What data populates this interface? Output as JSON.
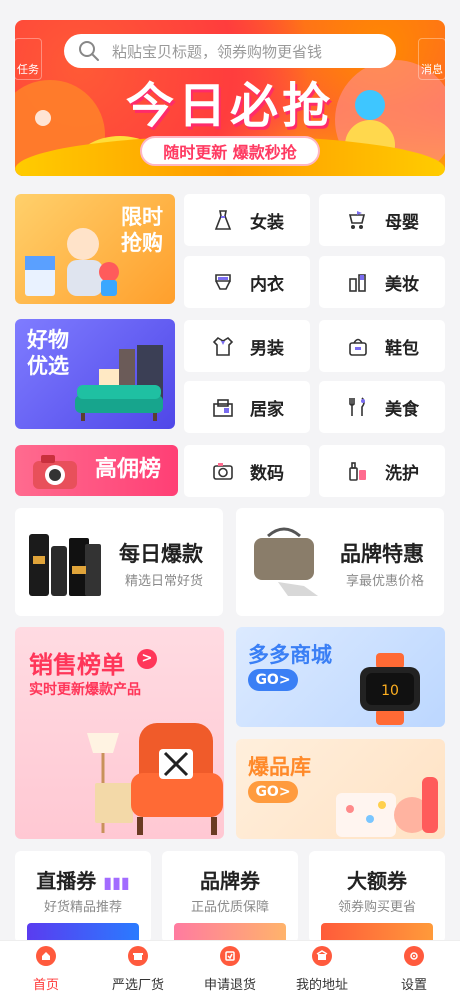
{
  "header": {
    "left_tag": "任务",
    "right_tag": "消息",
    "search_placeholder": "粘贴宝贝标题，领券购物更省钱",
    "banner_title": "今日必抢",
    "banner_pill": "随时更新 爆款秒抢"
  },
  "promos": {
    "limited": "限时\n抢购",
    "good": "好物\n优选",
    "high": "高佣榜"
  },
  "categories": [
    {
      "label": "女装",
      "icon": "dress-icon"
    },
    {
      "label": "母婴",
      "icon": "stroller-icon"
    },
    {
      "label": "内衣",
      "icon": "underwear-icon"
    },
    {
      "label": "美妆",
      "icon": "cosmetics-icon"
    },
    {
      "label": "男装",
      "icon": "shirt-icon"
    },
    {
      "label": "鞋包",
      "icon": "bag-icon"
    },
    {
      "label": "居家",
      "icon": "home-icon"
    },
    {
      "label": "美食",
      "icon": "utensils-icon"
    },
    {
      "label": "数码",
      "icon": "camera-icon"
    },
    {
      "label": "洗护",
      "icon": "bottles-icon"
    }
  ],
  "wide_cards": [
    {
      "title": "每日爆款",
      "subtitle": "精选日常好货"
    },
    {
      "title": "品牌特惠",
      "subtitle": "享最优惠价格"
    }
  ],
  "sales": {
    "title": "销售榜单",
    "arrow": ">",
    "subtitle": "实时更新爆款产品"
  },
  "duoduo": {
    "title": "多多商城",
    "go": "GO>"
  },
  "baopin": {
    "title": "爆品库",
    "go": "GO>"
  },
  "coupons": [
    {
      "title": "直播券",
      "subtitle": "好货精品推荐"
    },
    {
      "title": "品牌券",
      "subtitle": "正品优质保障"
    },
    {
      "title": "大额券",
      "subtitle": "领券购买更省"
    }
  ],
  "tabs": [
    {
      "label": "首页",
      "active": true
    },
    {
      "label": "严选厂货",
      "active": false
    },
    {
      "label": "申请退货",
      "active": false
    },
    {
      "label": "我的地址",
      "active": false
    },
    {
      "label": "设置",
      "active": false
    }
  ],
  "colors": {
    "accent": "#ff3a3a",
    "blue": "#3a7ff5",
    "orange": "#ff8a2a"
  }
}
